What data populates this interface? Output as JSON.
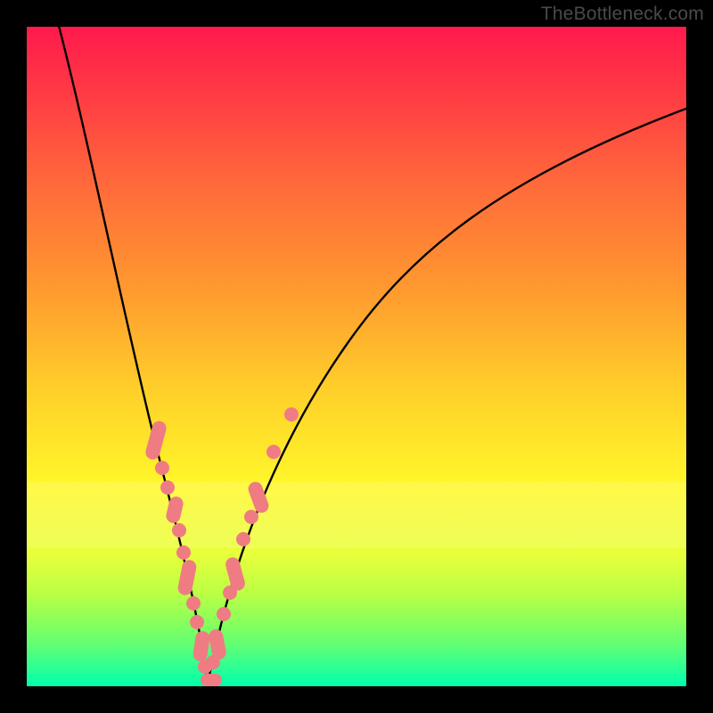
{
  "attribution": "TheBottleneck.com",
  "colors": {
    "bead": "#ef7c82",
    "curve": "#000000",
    "frame": "#000000"
  },
  "chart_data": {
    "type": "line",
    "title": "",
    "xlabel": "",
    "ylabel": "",
    "xlim": [
      0,
      100
    ],
    "ylim": [
      0,
      100
    ],
    "grid": false,
    "legend": false,
    "series": [
      {
        "name": "left-branch",
        "x": [
          5,
          10,
          14,
          18,
          21,
          23.5,
          25.4,
          27
        ],
        "y": [
          100,
          80,
          60,
          40,
          25,
          12,
          4,
          0
        ]
      },
      {
        "name": "right-branch",
        "x": [
          27,
          28.5,
          31,
          35,
          41,
          50,
          62,
          78,
          100
        ],
        "y": [
          0,
          4,
          13,
          27,
          42,
          57,
          70,
          80,
          88
        ]
      }
    ],
    "marker_clusters": [
      {
        "branch": "left",
        "x_range": [
          18,
          21
        ],
        "y_range": [
          25,
          40
        ]
      },
      {
        "branch": "left",
        "x_range": [
          22,
          24.5
        ],
        "y_range": [
          8,
          20
        ]
      },
      {
        "branch": "left",
        "x_range": [
          25,
          27
        ],
        "y_range": [
          0,
          5
        ]
      },
      {
        "branch": "right",
        "x_range": [
          27,
          29.5
        ],
        "y_range": [
          0,
          8
        ]
      },
      {
        "branch": "right",
        "x_range": [
          30,
          33
        ],
        "y_range": [
          12,
          22
        ]
      },
      {
        "branch": "right",
        "x_range": [
          34,
          36
        ],
        "y_range": [
          27,
          33
        ]
      }
    ],
    "notes": "V-shaped bottleneck curve over rainbow gradient; minimum near x≈27, y=0. Salmon-colored bead markers cluster along both branches near the trough."
  }
}
